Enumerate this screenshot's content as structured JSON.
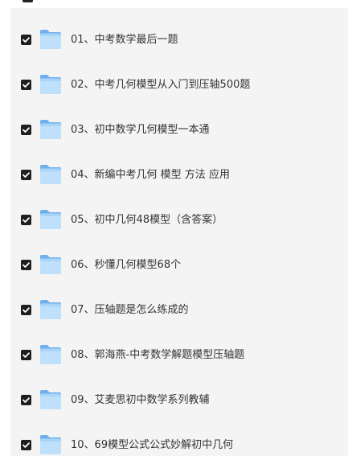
{
  "items": [
    {
      "label": "01、中考数学最后一题",
      "checked": true,
      "icon": "folder-icon"
    },
    {
      "label": "02、中考几何模型从入门到压轴500题",
      "checked": true,
      "icon": "folder-icon"
    },
    {
      "label": "03、初中数学几何模型一本通",
      "checked": true,
      "icon": "folder-icon"
    },
    {
      "label": "04、新编中考几何 模型 方法 应用",
      "checked": true,
      "icon": "folder-icon"
    },
    {
      "label": "05、初中几何48模型（含答案）",
      "checked": true,
      "icon": "folder-icon"
    },
    {
      "label": "06、秒懂几何模型68个",
      "checked": true,
      "icon": "folder-icon"
    },
    {
      "label": "07、压轴题是怎么练成的",
      "checked": true,
      "icon": "folder-icon"
    },
    {
      "label": "08、郭海燕-中考数学解题模型压轴题",
      "checked": true,
      "icon": "folder-icon"
    },
    {
      "label": "09、艾麦思初中数学系列教辅",
      "checked": true,
      "icon": "folder-icon"
    },
    {
      "label": "10、69模型公式公式妙解初中几何",
      "checked": true,
      "icon": "folder-icon"
    }
  ],
  "colors": {
    "panel_bg": "#f4f4f4",
    "checkbox_fill": "#1f1f1f",
    "folder_light": "#bfe0fb",
    "folder_mid": "#8ec6f5",
    "folder_dark": "#6fb0ec",
    "text": "#333333"
  }
}
